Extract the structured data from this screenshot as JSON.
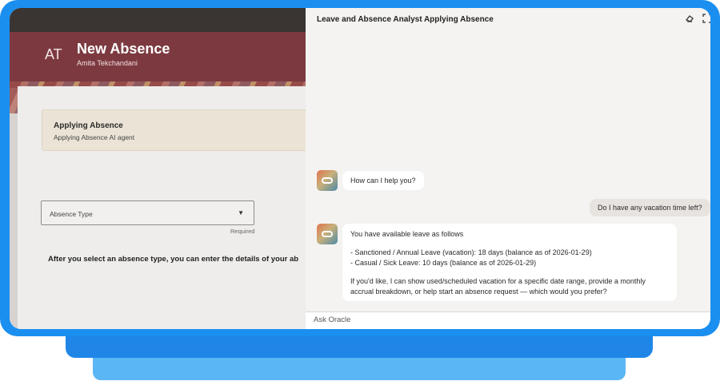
{
  "app": {
    "avatar_initials": "AT",
    "page_title": "New Absence",
    "user_name": "Amita Tekchandani"
  },
  "agent_card": {
    "title": "Applying Absence",
    "subtitle": "Applying Absence AI agent"
  },
  "form": {
    "absence_type_label": "Absence Type",
    "caret": "▼",
    "required_text": "Required",
    "instruction": "After you select an absence type, you can enter the details of your ab"
  },
  "chat": {
    "title": "Leave and Absence Analyst Applying Absence",
    "icons": {
      "clear": "eraser-icon",
      "expand": "expand-icon"
    },
    "bot_greeting": "How can I help you?",
    "user_question": "Do I have any vacation time left?",
    "bot_reply": {
      "intro": "You have available leave as follows",
      "line1": "- Sanctioned / Annual Leave (vacation): 18 days (balance as of 2026-01-29)",
      "line2": "- Casual / Sick Leave: 10 days (balance as of 2026-01-29)",
      "followup": "If you'd like, I can show used/scheduled vacation for a specific date range, provide a monthly accrual breakdown, or help start an absence request — which would you prefer?"
    },
    "input_placeholder": "Ask Oracle"
  },
  "colors": {
    "frame_blue": "#1b8ff0",
    "header_maroon": "#7c3a40",
    "agent_card_bg": "#ebe4d6"
  }
}
